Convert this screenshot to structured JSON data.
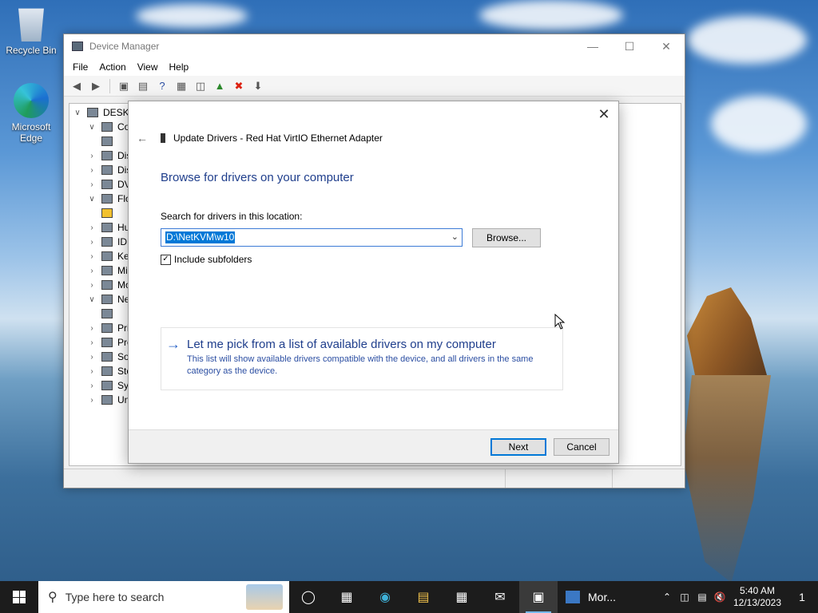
{
  "desktop": {
    "icons": [
      {
        "label": "Recycle Bin"
      },
      {
        "label": "Microsoft Edge"
      }
    ]
  },
  "device_manager": {
    "title": "Device Manager",
    "menu": [
      "File",
      "Action",
      "View",
      "Help"
    ],
    "tree": {
      "root": "DESKT",
      "items": [
        "Co",
        "Dis",
        "Dis",
        "DV",
        "Flo",
        "Hu",
        "IDE",
        "Ke",
        "Mi",
        "Mo",
        "Ne",
        "Pri",
        "Pro",
        "So",
        "Sto",
        "Sys",
        "Un"
      ]
    }
  },
  "dialog": {
    "caption": "Update Drivers - Red Hat VirtIO Ethernet Adapter",
    "heading": "Browse for drivers on your computer",
    "search_label": "Search for drivers in this location:",
    "path_value": "D:\\NetKVM\\w10",
    "browse_label": "Browse...",
    "include_subfolders": "Include subfolders",
    "include_subfolders_checked": true,
    "pick_title": "Let me pick from a list of available drivers on my computer",
    "pick_desc": "This list will show available drivers compatible with the device, and all drivers in the same category as the device.",
    "next_label": "Next",
    "cancel_label": "Cancel"
  },
  "taskbar": {
    "search_placeholder": "Type here to search",
    "running_label": "Mor...",
    "time": "5:40 AM",
    "date": "12/13/2023",
    "notification_count": "1"
  },
  "colors": {
    "accent": "#0078d7",
    "link_blue": "#1f3e8c",
    "taskbar": "#1c1c1c"
  }
}
